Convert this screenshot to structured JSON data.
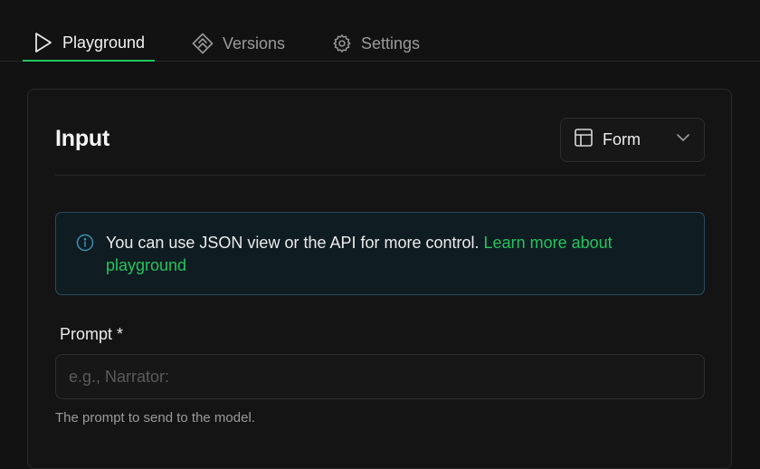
{
  "tabs": [
    {
      "label": "Playground",
      "icon": "play-icon",
      "active": true
    },
    {
      "label": "Versions",
      "icon": "versions-icon",
      "active": false
    },
    {
      "label": "Settings",
      "icon": "gear-icon",
      "active": false
    }
  ],
  "input_panel": {
    "title": "Input",
    "view_select": {
      "value": "Form",
      "icon": "layout-icon"
    }
  },
  "info": {
    "text": "You can use JSON view or the API for more control. ",
    "link": "Learn more about playground",
    "icon": "info-icon"
  },
  "prompt": {
    "label": "Prompt *",
    "placeholder": "e.g., Narrator:",
    "value": "",
    "help": "The prompt to send to the model."
  },
  "colors": {
    "accent": "#22c55e",
    "background": "#121212",
    "info_bg": "#0f1c22",
    "info_border": "#2a4c5c"
  }
}
